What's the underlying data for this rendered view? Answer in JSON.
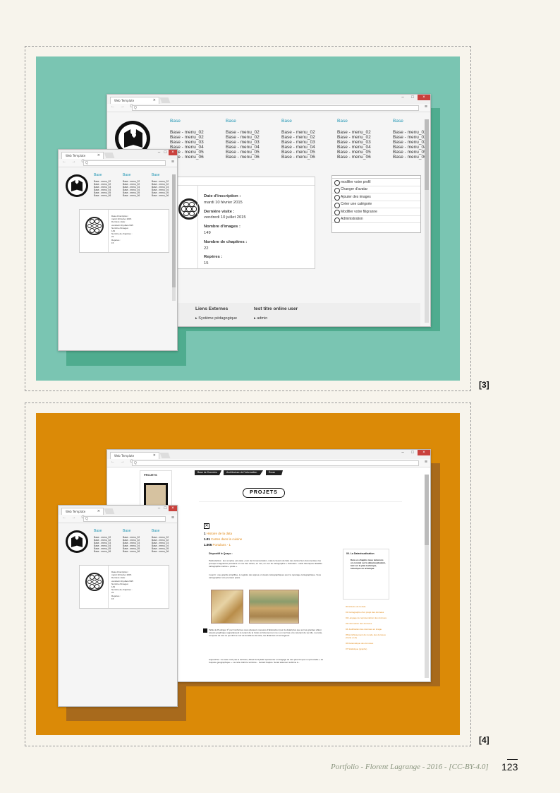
{
  "captions": {
    "fig3": "[3]",
    "fig4": "[4]"
  },
  "footer": {
    "credit": "Portfolio - Florent Lagrange - 2016 - [CC-BY-4.0]",
    "page_number": "123"
  },
  "colors": {
    "teal_panel": "#7ac5b2",
    "teal_shadow": "#4fac8f",
    "orange_panel": "#db8a07",
    "brown_shadow": "#a86a1c",
    "page_bg": "#f7f4ec",
    "link_blue": "#2196b4",
    "close_red": "#c9413d"
  },
  "browser": {
    "tab_title": "Web Template",
    "url": "Q",
    "close_glyph": "×",
    "min_glyph": "–",
    "max_glyph": "□",
    "nav": "← → C",
    "menu_glyph": "≡"
  },
  "fig3_large": {
    "menu": [
      {
        "head": "Base",
        "items": [
          "Base - menu_02",
          "Base - menu_02",
          "Base - menu_03",
          "Base - menu_04",
          "Base - menu_05",
          "Base - menu_06"
        ]
      },
      {
        "head": "Base",
        "items": [
          "Base - menu_02",
          "Base - menu_02",
          "Base - menu_03",
          "Base - menu_04",
          "Base - menu_05",
          "Base - menu_06"
        ]
      },
      {
        "head": "Base",
        "items": [
          "Base - menu_02",
          "Base - menu_02",
          "Base - menu_03",
          "Base - menu_04",
          "Base - menu_05",
          "Base - menu_06"
        ]
      },
      {
        "head": "Base",
        "items": [
          "Base - menu_02",
          "Base - menu_02",
          "Base - menu_03",
          "Base - menu_04",
          "Base - menu_05",
          "Base - menu_06"
        ]
      },
      {
        "head": "Base",
        "items": [
          "Base - menu_02",
          "Base - menu_02",
          "Base - menu_03",
          "Base - menu_04",
          "Base - menu_05",
          "Base - menu_06"
        ]
      }
    ],
    "profile": [
      {
        "label": "Date d'inscription :",
        "value": "mardi 10 février 2015"
      },
      {
        "label": "Dernière visite :",
        "value": "vendredi 10 juillet 2015"
      },
      {
        "label": "Nombre d'images :",
        "value": "149"
      },
      {
        "label": "Nombre de chapitres :",
        "value": "22"
      },
      {
        "label": "Repères :",
        "value": "15"
      }
    ],
    "actions": [
      "modifier votre profil",
      "Changer d'avatar",
      "Ajouter des images",
      "Créer une catégorie",
      "Modifier votre filigranne",
      "Administration"
    ],
    "footer_links": {
      "ext_head": "Liens Externes",
      "ext_item": "Système pédagogique",
      "online_head": "test titre online user",
      "online_item": "admin"
    }
  },
  "small_window": {
    "menu_heads": [
      "Base",
      "Base",
      "Base"
    ],
    "menu_items": [
      "Base - menu_02",
      "Base - menu_02",
      "Base - menu_03",
      "Base - menu_04",
      "Base - menu_05",
      "Base - menu_06"
    ],
    "profile_lines": [
      "Date d'inscription :",
      "mardi 10 février 2015",
      "Dernière visite :",
      "vendredi 10 juillet 2015",
      "Nombre d'images :",
      "149",
      "Nombre de chapitres :",
      "22",
      "Repères :",
      "15"
    ]
  },
  "fig4_large": {
    "sidebar_title": "PROJETS",
    "nav_tabs": [
      "Base de Données",
      "Architecture de l'information",
      "Écran"
    ],
    "heading": "PROJETS",
    "outline": [
      {
        "num": "1",
        "text": "Histoire de la data"
      },
      {
        "num": "1.01",
        "text": "Cartes dans la cuisine"
      },
      {
        "num": "1.005",
        "text": "Portulans - 1"
      }
    ],
    "intro_label": "Dispositif le Qozyo :",
    "body1": "Particularités : leur emprise est vaste « loin de l'ornementation, mais le besoin de faire des cartes bien documentées les presque imaginaires portulans en mer des cartes, en mer, en mer de cartographie » Portulans : outils théoriques détaillés cartographie marine « poste ».",
    "body2": "L'esprit : une graphie simplifiée, le registre des signes et visuels cartographiques pour le repérage cartographique. Vous cartographiez vos premiers plans.",
    "body3": "Table de Peutinger 1º par Conformes sous plusieurs mesures d'abstraction (sur du détail plus que sur les grandes villes) relevés graphiques apparaissent le tenant de la rivière si fortement en mer, en mer bas et le retenant de sa ville. La carte, composé de tout ce qui doit se voir de la taille de la carte, les distances et les largeurs.",
    "body4": "Aujourd'hui : la carte n'est pas le territoire, Alfred Korzybski représenter un langage du tout plus tôt que ce qu'il étudie « de l'espace géographique ». La carte trahit le territoire... Gérard Kaplan. Serait tellement sublime à...",
    "aside_title": "00. La Datavisualisation",
    "aside_text": "Dans ce chapitre nous tenterons un constat sur la datavisualisation, tant sur le plan technique, historique ou artistique.",
    "aside_links": [
      "00 Histoire de la data",
      "01 Cartographie d'un projet des données",
      "02 Langage de représentation des données",
      "03 Information des données",
      "04 Justification des données en image",
      "05 Enrichissement du monde des données (Carte et Ai)",
      "06 Datamatique des données",
      "07 Statistique (graphe)"
    ]
  }
}
